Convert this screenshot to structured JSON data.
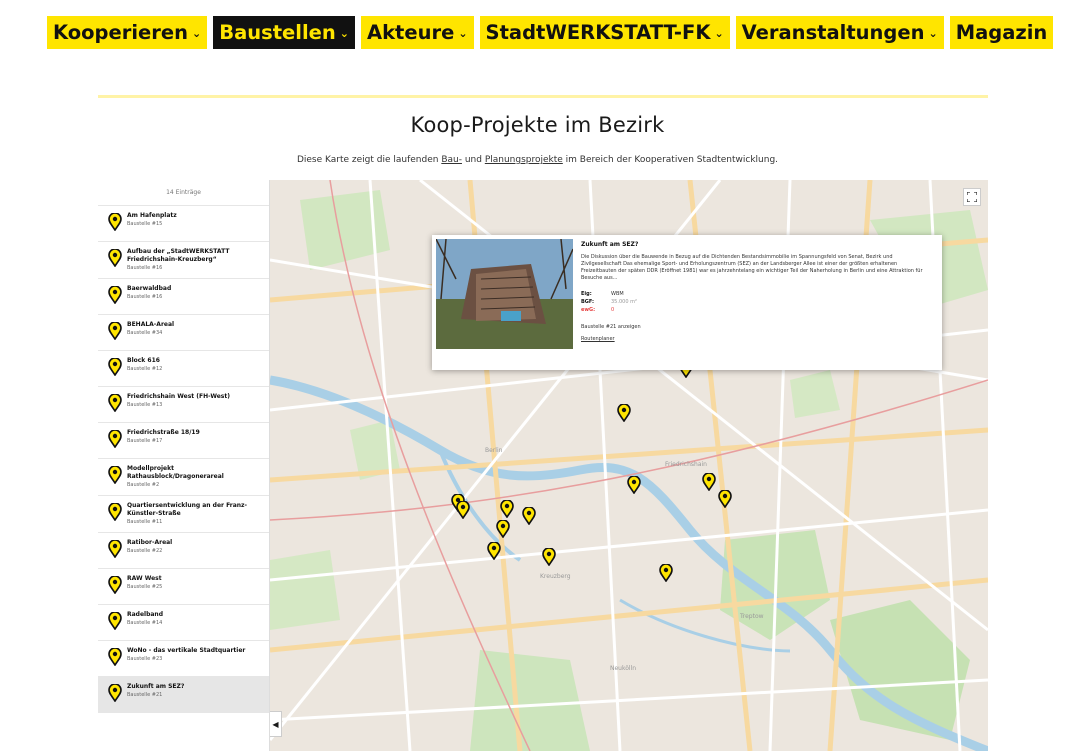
{
  "nav": [
    {
      "label": "Kooperieren",
      "chevron": "⌄",
      "active": false
    },
    {
      "label": "Baustellen",
      "chevron": "⌄",
      "active": true
    },
    {
      "label": "Akteure",
      "chevron": "⌄",
      "active": false
    },
    {
      "label": "StadtWERKSTATT-FK",
      "chevron": "⌄",
      "active": false
    },
    {
      "label": "Veranstaltungen",
      "chevron": "⌄",
      "active": false
    },
    {
      "label": "Magazin",
      "chevron": "",
      "active": false
    }
  ],
  "page": {
    "title": "Koop-Projekte im Bezirk",
    "intro_before": "Diese Karte zeigt die laufenden ",
    "intro_link1": "Bau-",
    "intro_mid": " und ",
    "intro_link2": "Planungsprojekte",
    "intro_after": " im Bereich der Kooperativen Stadtentwicklung."
  },
  "sidebar": {
    "count_label": "14 Einträge",
    "items": [
      {
        "name": "Am Hafenplatz",
        "sub": "Baustelle #15"
      },
      {
        "name": "Aufbau der „StadtWERKSTATT Friedrichshain-Kreuzberg“",
        "sub": "Baustelle #16"
      },
      {
        "name": "Baerwaldbad",
        "sub": "Baustelle #16"
      },
      {
        "name": "BEHALA-Areal",
        "sub": "Baustelle #34"
      },
      {
        "name": "Block 616",
        "sub": "Baustelle #12"
      },
      {
        "name": "Friedrichshain West (FH-West)",
        "sub": "Baustelle #13"
      },
      {
        "name": "Friedrichstraße 18/19",
        "sub": "Baustelle #17"
      },
      {
        "name": "Modellprojekt Rathausblock/Dragonerareal",
        "sub": "Baustelle #2"
      },
      {
        "name": "Quartiersentwicklung an der Franz-Künstler-Straße",
        "sub": "Baustelle #11"
      },
      {
        "name": "Ratibor-Areal",
        "sub": "Baustelle #22"
      },
      {
        "name": "RAW West",
        "sub": "Baustelle #25"
      },
      {
        "name": "Radelband",
        "sub": "Baustelle #14"
      },
      {
        "name": "WoNo - das vertikale Stadtquartier",
        "sub": "Baustelle #23"
      },
      {
        "name": "Zukunft am SEZ?",
        "sub": "Baustelle #21"
      }
    ]
  },
  "popup": {
    "title": "Zukunft am SEZ?",
    "description": "Die Diskussion über die Bauwende in Bezug auf die Dichtenden Bestandsimmobilie im Spannungsfeld von Senat, Bezirk und Zivilgesellschaft Das ehemalige Sport- und Erholungszentrum (SEZ) an der Landsberger Allee ist einer der größten erhaltenen Freizeitbauten der späten DDR (Eröffnet 1981) war es jahrzehntelang ein wichtiger Teil der Naherholung in Berlin und eine Attraktion für Besuche aus...",
    "kv": [
      {
        "k": "Eig:",
        "v": "WBM",
        "style": ""
      },
      {
        "k": "BGF:",
        "v": "35.000 m²",
        "style": "muted"
      },
      {
        "k": "ewG:",
        "v": "0",
        "style": "red"
      }
    ],
    "link_show": "Baustelle #21 anzeigen",
    "link_route": "Routenplaner"
  },
  "map": {
    "district_labels": [
      "Berlin",
      "Kreuzberg",
      "Friedrichshain",
      "Neukölln",
      "Treptow"
    ],
    "icons": {
      "fullscreen": "fullscreen-icon",
      "collapse": "chevron-left-icon",
      "pin": "map-pin-icon"
    }
  },
  "colors": {
    "nav": "#ffe500",
    "nav_active_bg": "#111111",
    "pin": "#ffe500",
    "rule": "#fff3a6",
    "accent_red": "#e63d3d"
  }
}
